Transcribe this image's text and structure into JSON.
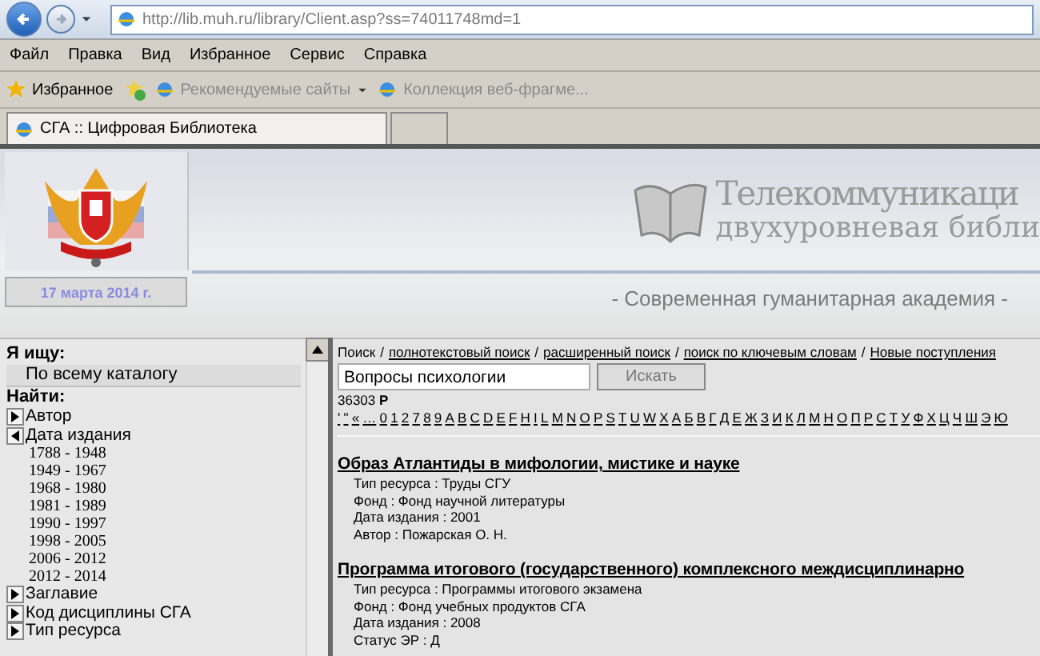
{
  "address_bar": {
    "url": "http://lib.muh.ru/library/Client.asp?ss=74011748md=1"
  },
  "menu": [
    "Файл",
    "Правка",
    "Вид",
    "Избранное",
    "Сервис",
    "Справка"
  ],
  "favorites_bar": {
    "favorites": "Избранное",
    "links": [
      {
        "label": "Рекомендуемые сайты",
        "dropdown": true
      },
      {
        "label": "Коллекция веб-фрагме...",
        "dropdown": false
      }
    ]
  },
  "tabs": [
    {
      "label": "СГА :: Цифровая Библиотека",
      "selected": true
    }
  ],
  "header": {
    "date": "17 марта 2014 г.",
    "banner_line_1": "Телекоммуникаци",
    "banner_line_2": "двухуровневая библи",
    "slogan": "- Современная гуманитарная академия -"
  },
  "sidebar": {
    "looking_for_label": "Я ищу:",
    "looking_for_value": "По всему каталогу",
    "find_label": "Найти:",
    "items": [
      {
        "label": "Автор",
        "expanded": false
      },
      {
        "label": "Дата издания",
        "expanded": true,
        "children": [
          {
            "label": "1788 - 1948"
          },
          {
            "label": "1949 - 1967"
          },
          {
            "label": "1968 - 1980"
          },
          {
            "label": "1981 - 1989"
          },
          {
            "label": "1990 - 1997"
          },
          {
            "label": "1998 - 2005"
          },
          {
            "label": "2006 - 2012"
          },
          {
            "label": "2012 - 2014"
          }
        ]
      },
      {
        "label": "Заглавие",
        "expanded": false
      },
      {
        "label": "Код дисциплины СГА",
        "expanded": false
      },
      {
        "label": "Тип ресурса",
        "expanded": false
      }
    ]
  },
  "search_nav": {
    "separator": "/",
    "items": [
      {
        "label": "Поиск",
        "link": false
      },
      {
        "label": "полнотекстовый поиск",
        "link": true
      },
      {
        "label": "расширенный поиск",
        "link": true
      },
      {
        "label": "поиск по ключевым словам",
        "link": true
      },
      {
        "label": "Новые поступления",
        "link": true
      }
    ]
  },
  "search": {
    "value": "Вопросы психологии",
    "button": "Искать"
  },
  "count": {
    "number": "36303",
    "letter": "Р"
  },
  "alphabet": [
    "'",
    "\"",
    "«",
    "…",
    "0",
    "1",
    "2",
    "7",
    "8",
    "9",
    "A",
    "B",
    "C",
    "D",
    "E",
    "F",
    "H",
    "I",
    "L",
    "M",
    "N",
    "O",
    "P",
    "S",
    "T",
    "U",
    "W",
    "X",
    "А",
    "Б",
    "В",
    "Г",
    "Д",
    "Е",
    "Ж",
    "З",
    "И",
    "К",
    "Л",
    "М",
    "Н",
    "О",
    "П",
    "Р",
    "С",
    "Т",
    "У",
    "Ф",
    "Х",
    "Ц",
    "Ч",
    "Ш",
    "Э",
    "Ю"
  ],
  "results": [
    {
      "title": "Образ Атлантиды в мифологии, мистике и науке",
      "fields": [
        "Тип ресурса  :  Труды СГУ",
        "Фонд  :  Фонд научной литературы",
        "Дата издания  :  2001",
        "Автор  :  Пожарская О. Н."
      ]
    },
    {
      "title": "Программа итогового (государственного) комплексного междисциплинарно",
      "fields": [
        "Тип ресурса  :  Программы итогового экзамена",
        "Фонд  :  Фонд учебных продуктов СГА",
        "Дата издания  :  2008",
        "Статус ЭР  :  Д"
      ]
    }
  ]
}
